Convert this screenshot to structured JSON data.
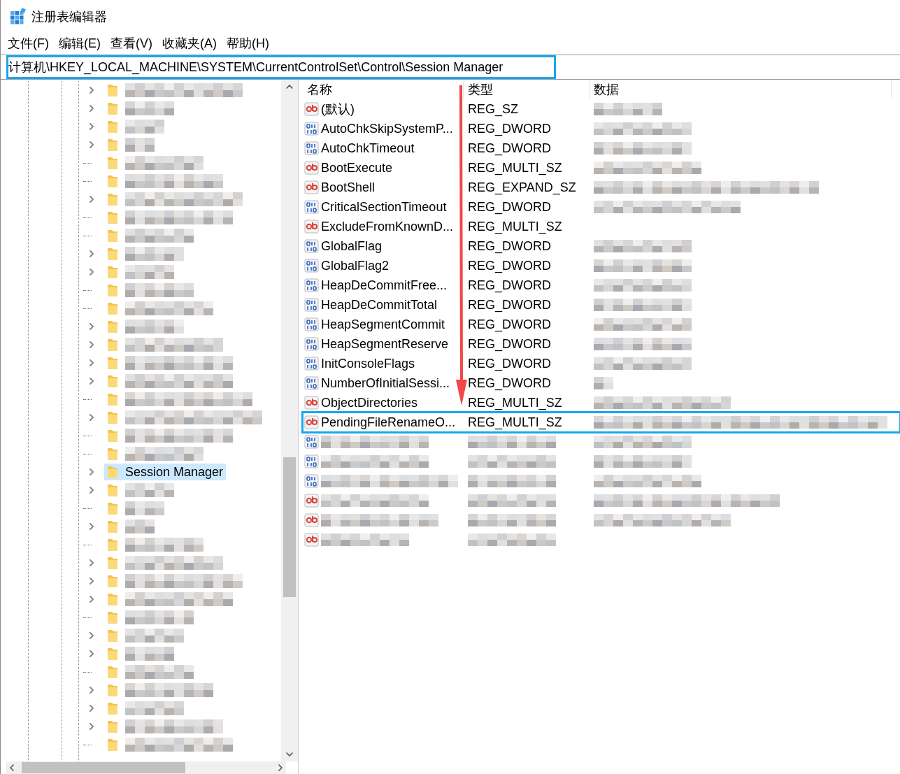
{
  "window": {
    "title": "注册表编辑器"
  },
  "menu": [
    "文件(F)",
    "编辑(E)",
    "查看(V)",
    "收藏夹(A)",
    "帮助(H)"
  ],
  "address": {
    "value": "计算机\\HKEY_LOCAL_MACHINE\\SYSTEM\\CurrentControlSet\\Control\\Session Manager",
    "highlighted": true
  },
  "tree": [
    {
      "expandable": true,
      "selected": false
    },
    {
      "expandable": true,
      "selected": false
    },
    {
      "expandable": true,
      "selected": false
    },
    {
      "expandable": true,
      "selected": false
    },
    {
      "expandable": false,
      "selected": false
    },
    {
      "expandable": false,
      "selected": false
    },
    {
      "expandable": true,
      "selected": false
    },
    {
      "expandable": false,
      "selected": false
    },
    {
      "expandable": false,
      "selected": false
    },
    {
      "expandable": true,
      "selected": false
    },
    {
      "expandable": true,
      "selected": false
    },
    {
      "expandable": false,
      "selected": false
    },
    {
      "expandable": false,
      "selected": false
    },
    {
      "expandable": true,
      "selected": false
    },
    {
      "expandable": true,
      "selected": false
    },
    {
      "expandable": true,
      "selected": false
    },
    {
      "expandable": true,
      "selected": false
    },
    {
      "expandable": false,
      "selected": false
    },
    {
      "expandable": true,
      "selected": false
    },
    {
      "expandable": false,
      "selected": false
    },
    {
      "expandable": false,
      "selected": false
    },
    {
      "expandable": true,
      "selected": true,
      "label": "Session Manager"
    },
    {
      "expandable": true,
      "selected": false
    },
    {
      "expandable": false,
      "selected": false
    },
    {
      "expandable": true,
      "selected": false
    },
    {
      "expandable": false,
      "selected": false
    },
    {
      "expandable": true,
      "selected": false
    },
    {
      "expandable": true,
      "selected": false
    },
    {
      "expandable": true,
      "selected": false
    },
    {
      "expandable": false,
      "selected": false
    },
    {
      "expandable": true,
      "selected": false
    },
    {
      "expandable": true,
      "selected": false
    },
    {
      "expandable": false,
      "selected": false
    },
    {
      "expandable": true,
      "selected": false
    },
    {
      "expandable": true,
      "selected": false
    },
    {
      "expandable": true,
      "selected": false
    },
    {
      "expandable": false,
      "selected": false
    }
  ],
  "table": {
    "columns": [
      "名称",
      "类型",
      "数据"
    ],
    "rows": [
      {
        "kind": "string",
        "name": "(默认)",
        "type": "REG_SZ",
        "highlighted": false
      },
      {
        "kind": "binary",
        "name": "AutoChkSkipSystemP...",
        "type": "REG_DWORD",
        "highlighted": false
      },
      {
        "kind": "binary",
        "name": "AutoChkTimeout",
        "type": "REG_DWORD",
        "highlighted": false
      },
      {
        "kind": "string",
        "name": "BootExecute",
        "type": "REG_MULTI_SZ",
        "highlighted": false
      },
      {
        "kind": "string",
        "name": "BootShell",
        "type": "REG_EXPAND_SZ",
        "highlighted": false
      },
      {
        "kind": "binary",
        "name": "CriticalSectionTimeout",
        "type": "REG_DWORD",
        "highlighted": false
      },
      {
        "kind": "string",
        "name": "ExcludeFromKnownD...",
        "type": "REG_MULTI_SZ",
        "highlighted": false
      },
      {
        "kind": "binary",
        "name": "GlobalFlag",
        "type": "REG_DWORD",
        "highlighted": false
      },
      {
        "kind": "binary",
        "name": "GlobalFlag2",
        "type": "REG_DWORD",
        "highlighted": false
      },
      {
        "kind": "binary",
        "name": "HeapDeCommitFree...",
        "type": "REG_DWORD",
        "highlighted": false
      },
      {
        "kind": "binary",
        "name": "HeapDeCommitTotal",
        "type": "REG_DWORD",
        "highlighted": false
      },
      {
        "kind": "binary",
        "name": "HeapSegmentCommit",
        "type": "REG_DWORD",
        "highlighted": false
      },
      {
        "kind": "binary",
        "name": "HeapSegmentReserve",
        "type": "REG_DWORD",
        "highlighted": false
      },
      {
        "kind": "binary",
        "name": "InitConsoleFlags",
        "type": "REG_DWORD",
        "highlighted": false
      },
      {
        "kind": "binary",
        "name": "NumberOfInitialSessi...",
        "type": "REG_DWORD",
        "highlighted": false
      },
      {
        "kind": "string",
        "name": "ObjectDirectories",
        "type": "REG_MULTI_SZ",
        "highlighted": false
      },
      {
        "kind": "string",
        "name": "PendingFileRenameO...",
        "type": "REG_MULTI_SZ",
        "highlighted": true
      },
      {
        "kind": "binary",
        "highlighted": false
      },
      {
        "kind": "binary",
        "highlighted": false
      },
      {
        "kind": "binary",
        "highlighted": false
      },
      {
        "kind": "string",
        "highlighted": false
      },
      {
        "kind": "string",
        "highlighted": false
      },
      {
        "kind": "string",
        "highlighted": false
      }
    ]
  }
}
